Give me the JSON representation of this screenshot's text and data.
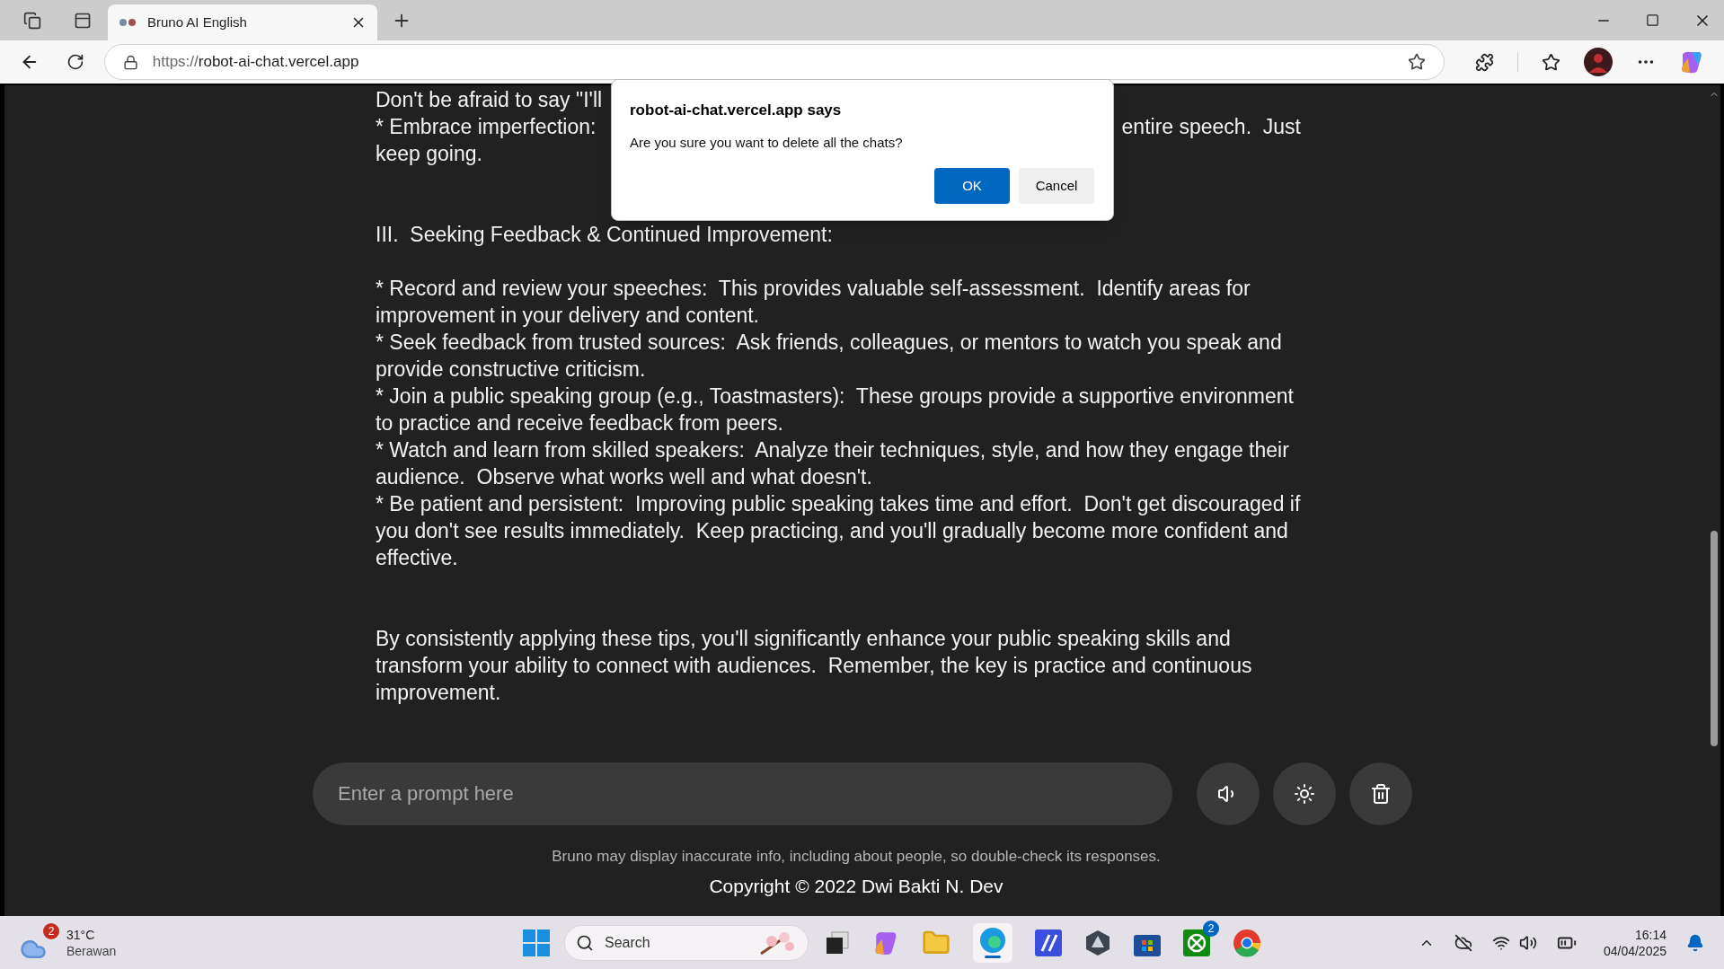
{
  "browser": {
    "tab_title": "Bruno AI English",
    "url_scheme": "https://",
    "url_host": "robot-ai-chat.vercel.app"
  },
  "chat": {
    "top_lines": [
      {
        "left": "Don't be afraid to say \"I'll"
      },
      {
        "left": "* Embrace imperfection:",
        "right": "entire speech.  Just"
      },
      {
        "left": "keep going."
      }
    ],
    "heading": "III.  Seeking Feedback & Continued Improvement:",
    "bullets": [
      "* Record and review your speeches:  This provides valuable self-assessment.  Identify areas for improvement in your delivery and content.",
      "* Seek feedback from trusted sources:  Ask friends, colleagues, or mentors to watch you speak and provide constructive criticism.",
      "* Join a public speaking group (e.g., Toastmasters):  These groups provide a supportive environment to practice and receive feedback from peers.",
      "* Watch and learn from skilled speakers:  Analyze their techniques, style, and how they engage their audience.  Observe what works well and what doesn't.",
      "* Be patient and persistent:  Improving public speaking takes time and effort.  Don't get discouraged if you don't see results immediately.  Keep practicing, and you'll gradually become more confident and effective."
    ],
    "closing": "By consistently applying these tips, you'll significantly enhance your public speaking skills and transform your ability to connect with audiences.  Remember, the key is practice and continuous improvement."
  },
  "prompt": {
    "placeholder": "Enter a prompt here"
  },
  "footer": {
    "disclaimer": "Bruno may display inaccurate info, including about people, so double-check its responses.",
    "copyright": "Copyright © 2022 Dwi Bakti N. Dev"
  },
  "dialog": {
    "title": "robot-ai-chat.vercel.app says",
    "message": "Are you sure you want to delete all the chats?",
    "buttons": [
      "OK",
      "Cancel"
    ]
  },
  "taskbar": {
    "weather_badge": "2",
    "temperature": "31°C",
    "condition": "Berawan",
    "search": "Search",
    "xbox_badge": "2",
    "time": "16:14",
    "date": "04/04/2025"
  }
}
